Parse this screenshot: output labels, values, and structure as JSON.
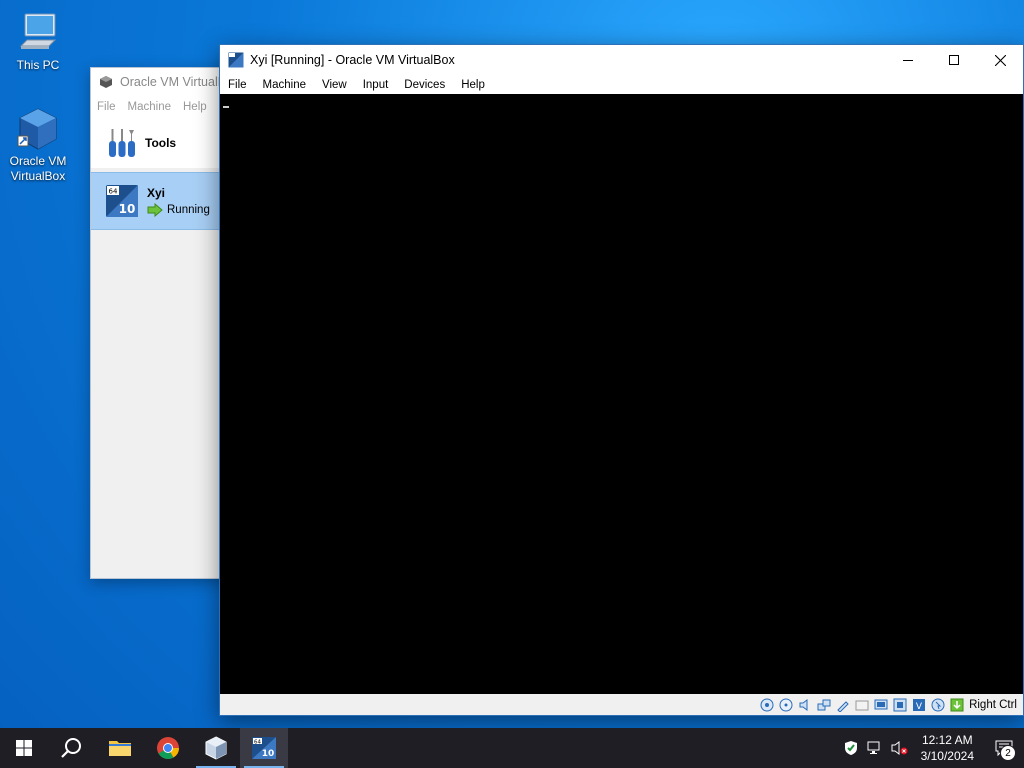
{
  "desktop": {
    "icons": [
      {
        "label": "This PC"
      },
      {
        "label": "Oracle VM VirtualBox"
      }
    ]
  },
  "manager": {
    "title": "Oracle VM VirtualBo",
    "menu": [
      "File",
      "Machine",
      "Help"
    ],
    "tools_label": "Tools",
    "vm": {
      "name": "Xyi",
      "state": "Running",
      "os_badge": "10",
      "arch_badge": "64"
    }
  },
  "vm_window": {
    "title": "Xyi [Running] - Oracle VM VirtualBox",
    "menu": [
      "File",
      "Machine",
      "View",
      "Input",
      "Devices",
      "Help"
    ],
    "host_key": "Right Ctrl"
  },
  "taskbar": {
    "time": "12:12 AM",
    "date": "3/10/2024",
    "notification_count": "2"
  },
  "colors": {
    "accent": "#0078d7",
    "selection": "#a8cff5",
    "taskbar": "#1e1e24"
  }
}
